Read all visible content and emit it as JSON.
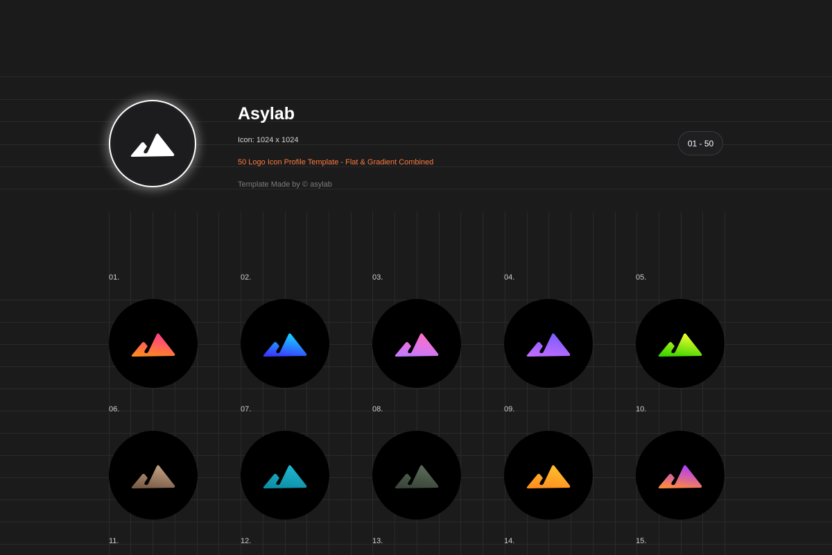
{
  "header": {
    "brand_name": "Asylab",
    "icon_size": "Icon: 1024 x 1024",
    "tagline": "50 Logo Icon Profile Template - Flat & Gradient Combined",
    "credit": "Template Made by © asylab",
    "range": "01 - 50",
    "hero_icon": "mountain-logo-icon",
    "hero_color": "#ffffff"
  },
  "icons": [
    {
      "label": "01.",
      "colors": [
        "#ff3d8b",
        "#ff8a1e"
      ]
    },
    {
      "label": "02.",
      "colors": [
        "#13d6ff",
        "#3a37ff"
      ]
    },
    {
      "label": "03.",
      "colors": [
        "#ff6ec4",
        "#c47aff"
      ]
    },
    {
      "label": "04.",
      "colors": [
        "#7a5cff",
        "#c06cff"
      ]
    },
    {
      "label": "05.",
      "colors": [
        "#f4ff2e",
        "#3cd400"
      ]
    },
    {
      "label": "06.",
      "colors": [
        "#c2a184",
        "#7a5b45"
      ]
    },
    {
      "label": "07.",
      "colors": [
        "#1fb7d0",
        "#0e8ea6"
      ]
    },
    {
      "label": "08.",
      "colors": [
        "#5b6b5a",
        "#3a4638"
      ]
    },
    {
      "label": "09.",
      "colors": [
        "#ffc02e",
        "#ff8f1e"
      ]
    },
    {
      "label": "10.",
      "colors": [
        "#b13cff",
        "#ff8a3d"
      ]
    }
  ],
  "next_labels": [
    "11.",
    "12.",
    "13.",
    "14.",
    "15."
  ]
}
